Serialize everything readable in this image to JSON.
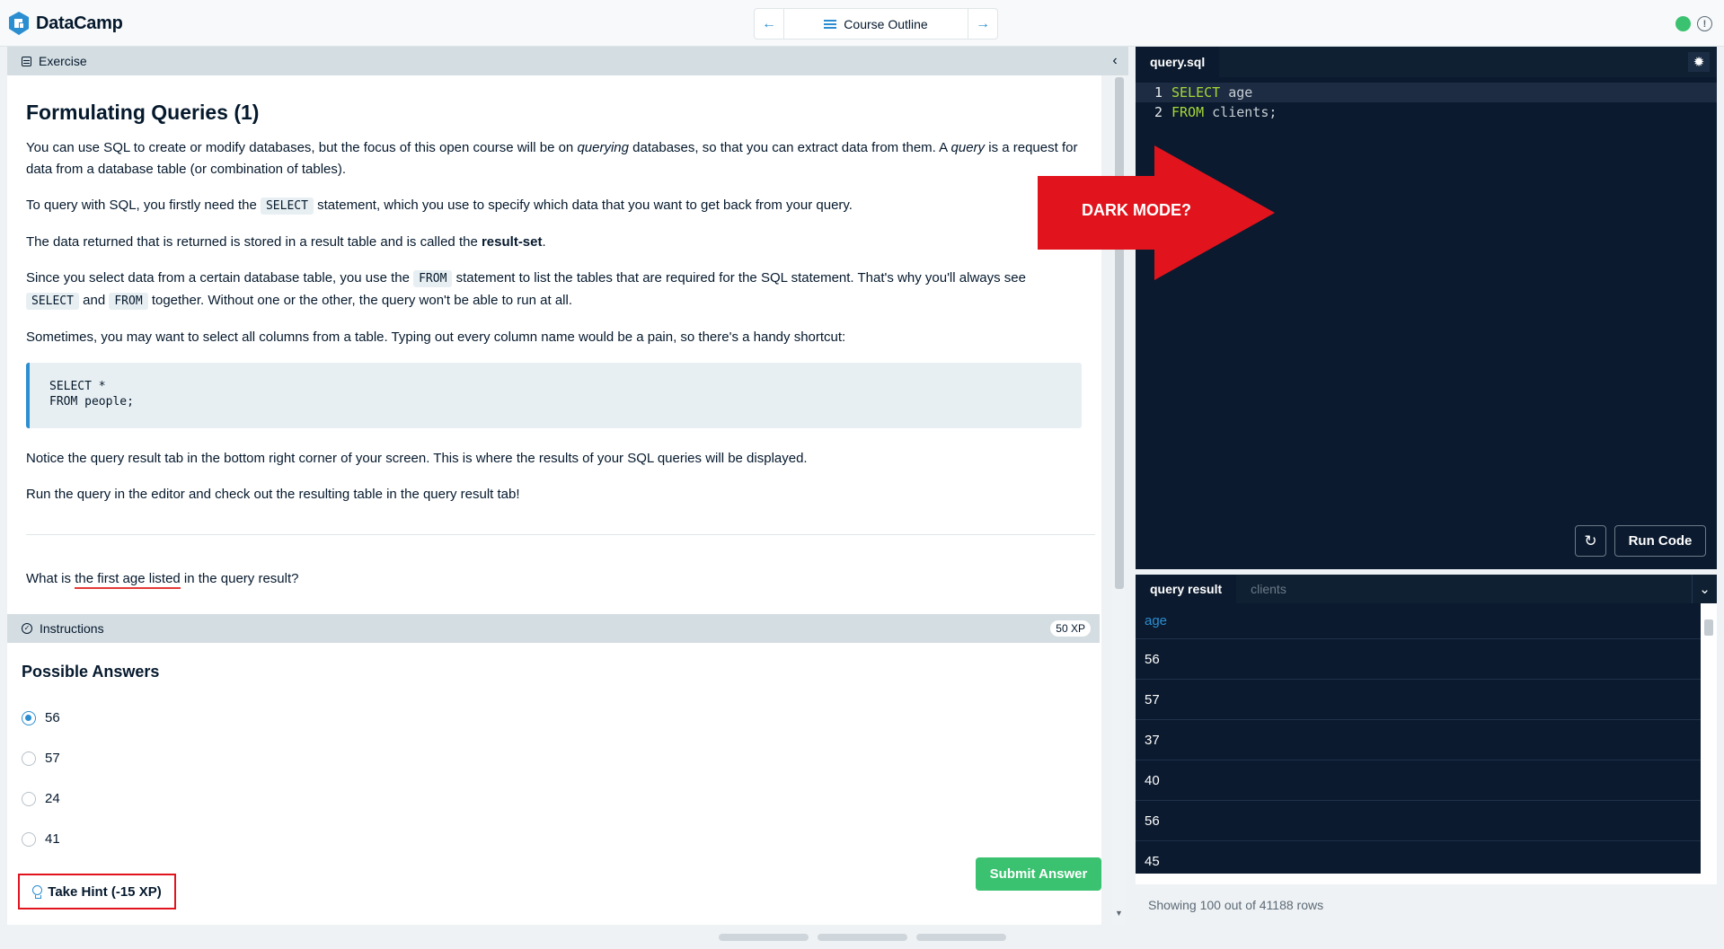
{
  "app": {
    "name": "DataCamp",
    "nav": {
      "center_label": "Course Outline",
      "prev": "←",
      "next": "→"
    }
  },
  "exercise": {
    "header": "Exercise",
    "title": "Formulating Queries (1)",
    "p1_a": "You can use SQL to create or modify databases, but the focus of this open course will be on ",
    "p1_em1": "querying",
    "p1_b": " databases, so that you can extract data from them. A ",
    "p1_em2": "query",
    "p1_c": " is a request for data from a database table (or combination of tables).",
    "p2_a": "To query with SQL, you firstly need the ",
    "p2_code": "SELECT",
    "p2_b": " statement, which you use to specify which data that you want to get back from your query.",
    "p3_a": "The data returned that is returned is stored in a result table and is called the ",
    "p3_strong": "result-set",
    "p3_b": ".",
    "p4_a": "Since you select data from a certain database table, you use the ",
    "p4_code1": "FROM",
    "p4_b": " statement to list the tables that are required for the SQL statement. That's why you'll always see ",
    "p4_code2": "SELECT",
    "p4_c": " and ",
    "p4_code3": "FROM",
    "p4_d": " together. Without one or the other, the query won't be able to run at all.",
    "p5": "Sometimes, you may want to select all columns from a table. Typing out every column name would be a pain, so there's a handy shortcut:",
    "codeblock": "SELECT *\nFROM people;",
    "p6": "Notice the query result tab in the bottom right corner of your screen. This is where the results of your SQL queries will be displayed.",
    "p7": "Run the query in the editor and check out the resulting table in the query result tab!",
    "question_a": "What is ",
    "question_u": "the first age listed",
    "question_b": " in the query result?"
  },
  "instructions": {
    "header": "Instructions",
    "xp": "50 XP",
    "answers_title": "Possible Answers",
    "answers": [
      "56",
      "57",
      "24",
      "41"
    ],
    "selected_index": 0,
    "submit_label": "Submit Answer",
    "hint_label": "Take Hint (-15 XP)"
  },
  "editor": {
    "tab": "query.sql",
    "lines": [
      {
        "num": "1",
        "kw": "SELECT",
        "rest": " age"
      },
      {
        "num": "2",
        "kw": "FROM",
        "rest": " clients;"
      }
    ],
    "run_label": "Run Code"
  },
  "results": {
    "tabs": [
      "query result",
      "clients"
    ],
    "column": "age",
    "rows": [
      "56",
      "57",
      "37",
      "40",
      "56",
      "45"
    ],
    "footer": "Showing 100 out of 41188 rows"
  },
  "annotation": {
    "label": "DARK MODE?"
  },
  "colors": {
    "accent": "#2b8ed1",
    "success": "#3ac270",
    "editor_bg": "#0b1a2e",
    "annotation_red": "#e1141d"
  }
}
